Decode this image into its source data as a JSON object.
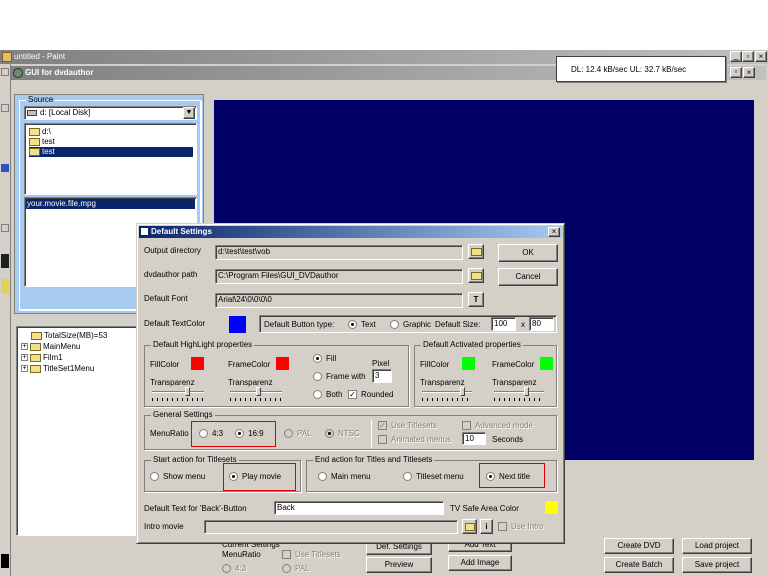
{
  "paint_window": {
    "title": "untitled - Paint"
  },
  "dvd_window": {
    "title": "GUI for dvdauthor"
  },
  "network_widget": {
    "text": "DL: 12.4 kB/sec  UL: 32.7 kB/sec"
  },
  "source_panel": {
    "label": "Source",
    "drive": "d: [Local Disk]",
    "folders": [
      "d:\\",
      "test",
      "test"
    ],
    "file": "your.movie.file.mpg"
  },
  "tree": {
    "items": [
      "TotalSize(MB)=53",
      "MainMenu",
      "Film1",
      "TitleSet1Menu"
    ]
  },
  "bottom_panel": {
    "current_settings": "Current Settings",
    "menu_ratio": "MenuRatio",
    "use_titlesets": "Use Titlesets",
    "r43": "4:3",
    "pal": "PAL",
    "def_settings": "Def. Settings",
    "add_text": "Add Text",
    "preview": "Preview",
    "add_image": "Add Image",
    "create_dvd": "Create DVD",
    "load_project": "Load project",
    "create_batch": "Create Batch",
    "save_project": "Save project"
  },
  "dialog": {
    "title": "Default Settings",
    "close": "×",
    "output_label": "Output directory",
    "output_value": "d:\\test\\test\\vob",
    "dvdauthor_label": "dvdauthor path",
    "dvdauthor_value": "C:\\Program Files\\GUI_DVDauthor",
    "font_label": "Default Font",
    "font_value": "Arial\\24\\0\\0\\0\\0",
    "font_btn": "T",
    "ok": "OK",
    "cancel": "Cancel",
    "textcolor_label": "Default TextColor",
    "button_type_label": "Default Button type:",
    "type_text": "Text",
    "type_graphic": "Graphic",
    "default_size_label": "Default Size:",
    "size_w": "100",
    "size_x": "x",
    "size_h": "80",
    "hl_group": "Default HighLight properties",
    "fillcolor": "FillColor",
    "framecolor": "FrameColor",
    "transparenz": "Transparenz",
    "fill": "Fill",
    "frame_with": "Frame with",
    "pixel": "Pixel",
    "pixel_value": "3",
    "both": "Both",
    "rounded": "Rounded",
    "act_group": "Default Activated properties",
    "gen_group": "General Settings",
    "menuratio": "MenuRatio",
    "r43": "4:3",
    "r169": "16:9",
    "pal": "PAL",
    "ntsc": "NTSC",
    "use_titlesets": "Use Titlesets",
    "animated_menus": "Animated menus",
    "advanced_mode": "Advanced mode",
    "seconds_value": "10",
    "seconds": "Seconds",
    "start_group": "Start action for Titlesets",
    "show_menu": "Show menu",
    "play_movie": "Play movie",
    "end_group": "End action for Titles and Titlesets",
    "main_menu": "Main menu",
    "titleset_menu": "Titleset menu",
    "next_title": "Next title",
    "back_label": "Default Text for 'Back'-Button",
    "back_value": "Back",
    "tv_safe": "TV Safe Area Color",
    "intro_label": "Intro movie",
    "intro_info": "i",
    "use_intro": "Use Intro"
  },
  "colors": {
    "textcolor": "#0000ff",
    "hl_fill": "#ff0000",
    "hl_frame": "#ff0000",
    "act_fill": "#00ff00",
    "act_frame": "#00ff00",
    "tv_safe": "#ffff00",
    "preview_bg": "#000066"
  }
}
